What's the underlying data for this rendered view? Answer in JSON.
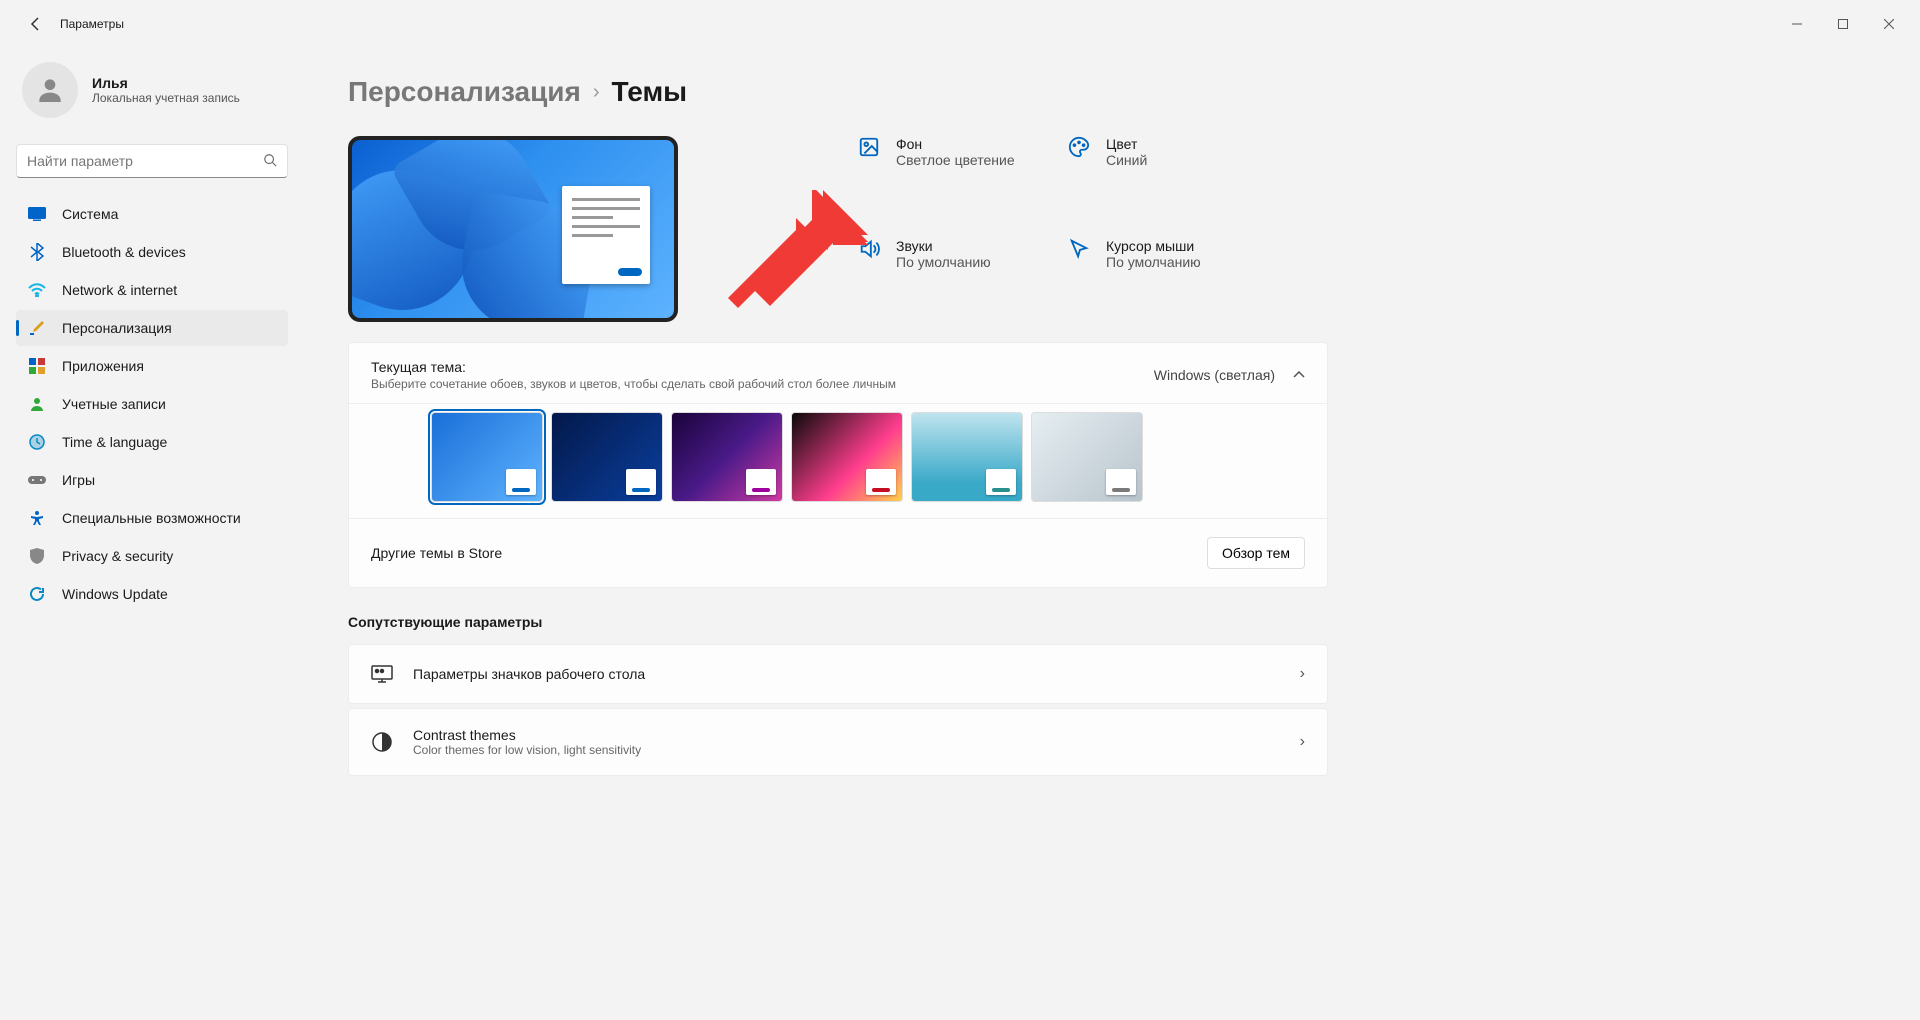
{
  "window": {
    "title": "Параметры"
  },
  "profile": {
    "name": "Илья",
    "sub": "Локальная учетная запись"
  },
  "search": {
    "placeholder": "Найти параметр"
  },
  "nav": {
    "items": [
      {
        "label": "Система"
      },
      {
        "label": "Bluetooth & devices"
      },
      {
        "label": "Network & internet"
      },
      {
        "label": "Персонализация"
      },
      {
        "label": "Приложения"
      },
      {
        "label": "Учетные записи"
      },
      {
        "label": "Time & language"
      },
      {
        "label": "Игры"
      },
      {
        "label": "Специальные возможности"
      },
      {
        "label": "Privacy & security"
      },
      {
        "label": "Windows Update"
      }
    ]
  },
  "breadcrumb": {
    "parent": "Персонализация",
    "current": "Темы"
  },
  "themeProps": {
    "background": {
      "title": "Фон",
      "value": "Светлое цветение"
    },
    "color": {
      "title": "Цвет",
      "value": "Синий"
    },
    "sounds": {
      "title": "Звуки",
      "value": "По умолчанию"
    },
    "cursor": {
      "title": "Курсор мыши",
      "value": "По умолчанию"
    }
  },
  "currentTheme": {
    "title": "Текущая тема:",
    "sub": "Выберите сочетание обоев, звуков и цветов, чтобы сделать свой рабочий стол более личным",
    "selected": "Windows (светлая)",
    "thumbs": [
      {
        "accent": "#0067c0",
        "bg": "linear-gradient(135deg,#1a6fd8,#5eb3ff)"
      },
      {
        "accent": "#0067c0",
        "bg": "linear-gradient(135deg,#03184a,#0a3f9e)"
      },
      {
        "accent": "#a0009e",
        "bg": "linear-gradient(135deg,#1a033a,#4a1a88,#d13aa3)"
      },
      {
        "accent": "#c40d22",
        "bg": "linear-gradient(135deg,#0a0a0a,#ff3e8e 60%,#ffd04a)"
      },
      {
        "accent": "#2a8f8f",
        "bg": "linear-gradient(180deg,#bfe4ef,#39a9c8 80%)"
      },
      {
        "accent": "#7a7a7a",
        "bg": "linear-gradient(135deg,#e6eef2,#b8c4cc)"
      }
    ]
  },
  "storeThemes": {
    "label": "Другие темы в Store",
    "button": "Обзор тем"
  },
  "related": {
    "title": "Сопутствующие параметры",
    "rows": [
      {
        "title": "Параметры значков рабочего стола",
        "sub": ""
      },
      {
        "title": "Contrast themes",
        "sub": "Color themes for low vision, light sensitivity"
      }
    ]
  }
}
